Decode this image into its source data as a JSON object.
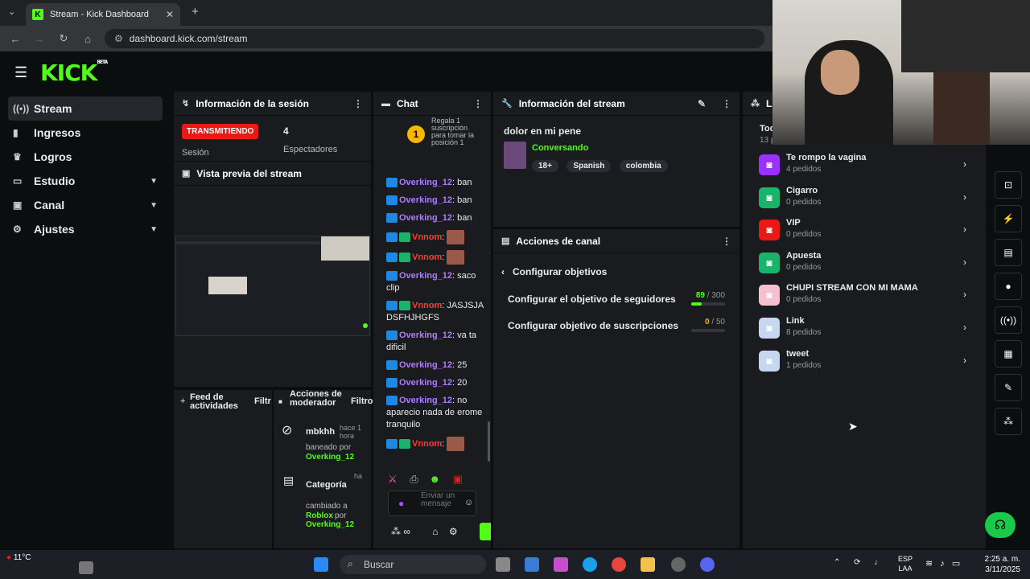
{
  "browser": {
    "tab_title": "Stream - Kick Dashboard",
    "url": "dashboard.kick.com/stream"
  },
  "brand": {
    "logo": "KICK",
    "beta": "BETA"
  },
  "sidebar": {
    "items": [
      {
        "label": "Stream",
        "icon": "broadcast-icon"
      },
      {
        "label": "Ingresos",
        "icon": "chart-icon"
      },
      {
        "label": "Logros",
        "icon": "trophy-icon"
      },
      {
        "label": "Estudio",
        "icon": "studio-icon"
      },
      {
        "label": "Canal",
        "icon": "tv-icon"
      },
      {
        "label": "Ajustes",
        "icon": "gear-icon"
      }
    ]
  },
  "session": {
    "title": "Información de la sesión",
    "badge": "TRANSMITIENDO",
    "label": "Sesión",
    "viewers": "4",
    "viewers_label": "Espectadores"
  },
  "preview": {
    "title": "Vista previa del stream"
  },
  "feed": {
    "title": "Feed de actividades",
    "filter": "Filtr"
  },
  "modacts": {
    "title": "Acciones de moderador",
    "filter": "Filtro",
    "items": [
      {
        "user": "mbkhh",
        "time": "hace 1 hora",
        "desc": "baneado por",
        "by": "Overking_12"
      },
      {
        "user": "Categoría",
        "time": "ha",
        "desc": "cambiado a",
        "target": "Roblox",
        "por": "por",
        "by": "Overking_12"
      }
    ]
  },
  "chat": {
    "title": "Chat",
    "gift_rank": "1",
    "gift_text": "Regala 1 suscripción para tomar la posición 1",
    "input_placeholder": "Enviar un mensaje",
    "messages": [
      {
        "user": "Overking_12",
        "text": ": ban",
        "cls": "u1"
      },
      {
        "user": "Overking_12",
        "text": ": ban",
        "cls": "u1"
      },
      {
        "user": "Overking_12",
        "text": ": ban",
        "cls": "u1"
      },
      {
        "user": "Vnnom",
        "text": ":",
        "cls": "u2",
        "emote": true
      },
      {
        "user": "Vnnom",
        "text": ":",
        "cls": "u2",
        "emote": true
      },
      {
        "user": "Overking_12",
        "text": ": saco clip",
        "cls": "u1"
      },
      {
        "user": "Vnnom",
        "text": ": JASJSJADSFHJHGFS",
        "cls": "u2"
      },
      {
        "user": "Overking_12",
        "text": ": va ta dificil",
        "cls": "u1"
      },
      {
        "user": "Overking_12",
        "text": ": 25",
        "cls": "u1"
      },
      {
        "user": "Overking_12",
        "text": ": 20",
        "cls": "u1"
      },
      {
        "user": "Overking_12",
        "text": ": no aparecio nada de erome tranquilo",
        "cls": "u1"
      },
      {
        "user": "Vnnom",
        "text": ":",
        "cls": "u2",
        "emote": true
      }
    ]
  },
  "stream_info": {
    "title": "Información del stream",
    "stream_title": "dolor en mi pene",
    "category": "Conversando",
    "tags": [
      "18+",
      "Spanish",
      "colombia"
    ]
  },
  "channel_actions": {
    "title": "Acciones de canal",
    "back_label": "Configurar objetivos",
    "goals": [
      {
        "label": "Configurar el objetivo de seguidores",
        "current": "89",
        "target": "/ 300",
        "progress": 0.3
      },
      {
        "label": "Configurar objetivo de suscripciones",
        "current": "0",
        "target": "/ 50",
        "progress": 0.0
      }
    ]
  },
  "rewards": {
    "title": "Li",
    "header_partial": "Toc",
    "count_partial": "13 p",
    "items": [
      {
        "name": "Te rompo la vagina",
        "orders": "4 pedidos",
        "color": "#9b30ff"
      },
      {
        "name": "Cigarro",
        "orders": "0 pedidos",
        "color": "#19b36b"
      },
      {
        "name": "VIP",
        "orders": "0 pedidos",
        "color": "#e91916"
      },
      {
        "name": "Apuesta",
        "orders": "0 pedidos",
        "color": "#19b36b"
      },
      {
        "name": "CHUPI STREAM CON MI MAMA",
        "orders": "0 pedidos",
        "color": "#f5c0cf"
      },
      {
        "name": "Link",
        "orders": "8 pedidos",
        "color": "#c7d7ef"
      },
      {
        "name": "tweet",
        "orders": "1 pedidos",
        "color": "#c7d7ef"
      }
    ]
  },
  "taskbar": {
    "weather": "11°C",
    "search": "Buscar",
    "lang1": "ESP",
    "lang2": "LAA",
    "time": "2:25 a. m.",
    "date": "3/11/2025"
  }
}
